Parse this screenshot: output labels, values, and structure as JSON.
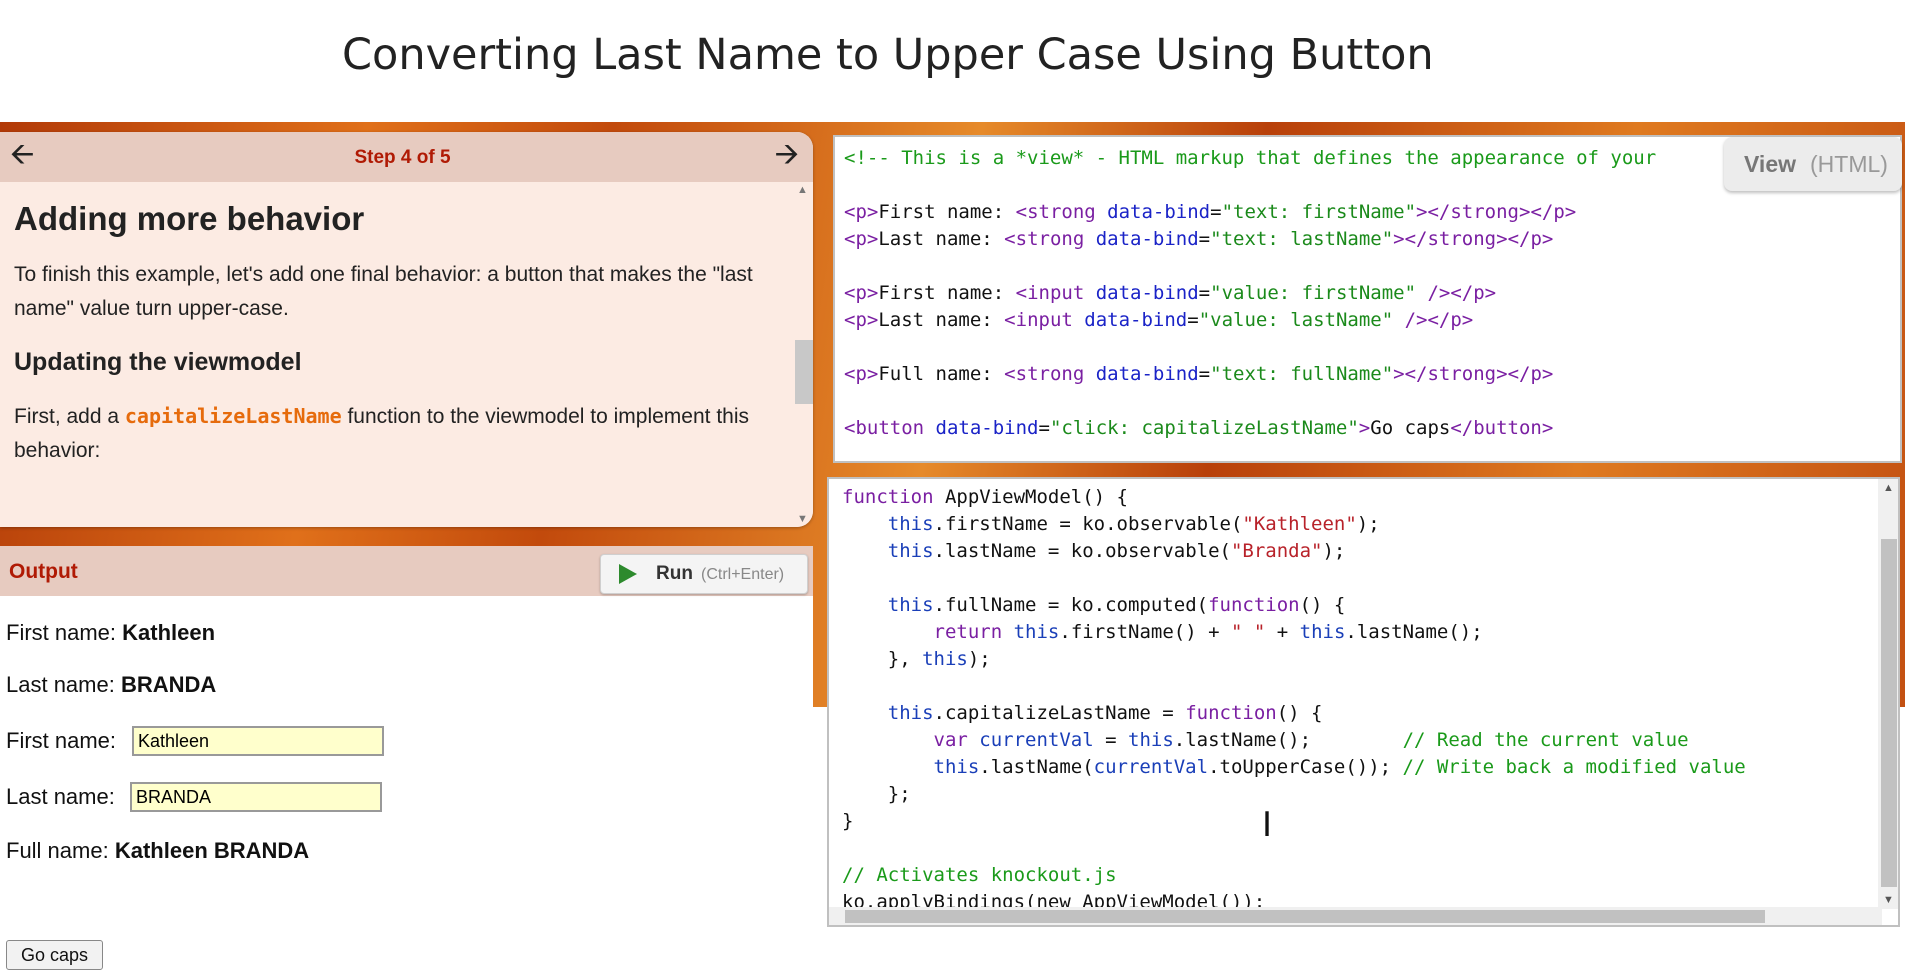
{
  "page": {
    "title": "Converting Last Name to Upper Case Using Button"
  },
  "tutorial": {
    "step_label": "Step 4 of 5",
    "prev_icon": "arrow-left-icon",
    "next_icon": "arrow-right-icon",
    "heading": "Adding more behavior",
    "intro": "To finish this example, let's add one final behavior: a button that makes the \"last name\" value turn upper-case.",
    "subheading": "Updating the viewmodel",
    "body_prefix": "First, add a ",
    "body_keyword": "capitalizeLastName",
    "body_suffix": " function to the viewmodel to implement this behavior:"
  },
  "output": {
    "title": "Output",
    "run_button": {
      "label": "Run",
      "hint": "(Ctrl+Enter)",
      "icon": "play-icon"
    },
    "rows": {
      "first_name_label": "First name:",
      "first_name_value": "Kathleen",
      "last_name_label": "Last name:",
      "last_name_value": "BRANDA",
      "first_input_label": "First name:",
      "first_input_value": "Kathleen",
      "last_input_label": "Last name:",
      "last_input_value": "BRANDA",
      "full_name_label": "Full name:",
      "full_name_value": "Kathleen BRANDA"
    },
    "go_caps_label": "Go caps"
  },
  "html_editor": {
    "view_label": "View",
    "view_sub": "(HTML)",
    "comment": "<!-- This is a *view* - HTML markup that defines the appearance of your",
    "lines": [
      {
        "tag": "strong",
        "label": "First name: ",
        "binding": "\"text: firstName\""
      },
      {
        "tag": "strong",
        "label": "Last name: ",
        "binding": "\"text: lastName\""
      },
      {
        "tag": "input",
        "label": "First name: ",
        "binding": "\"value: firstName\""
      },
      {
        "tag": "input",
        "label": "Last name: ",
        "binding": "\"value: lastName\""
      },
      {
        "tag": "strong",
        "label": "Full name: ",
        "binding": "\"text: fullName\""
      }
    ],
    "button_binding": "\"click: capitalizeLastName\"",
    "button_text": "Go caps"
  },
  "js_editor": {
    "l1_fn": "function",
    "l1_rest": " AppViewModel() {",
    "first_name_str": "\"Kathleen\"",
    "last_name_str": "\"Branda\"",
    "separator_str": "\" \"",
    "comment_read": "// Read the current value",
    "comment_write": "// Write back a modified value",
    "comment_activate": "// Activates knockout.js",
    "apply_line": "ko.applyBindings(new AppViewModel());"
  },
  "colors": {
    "accent_red": "#b01a04",
    "keyword_orange": "#e66b0c",
    "output_input_bg": "#ffffcc",
    "run_green": "#2d8a2d"
  }
}
